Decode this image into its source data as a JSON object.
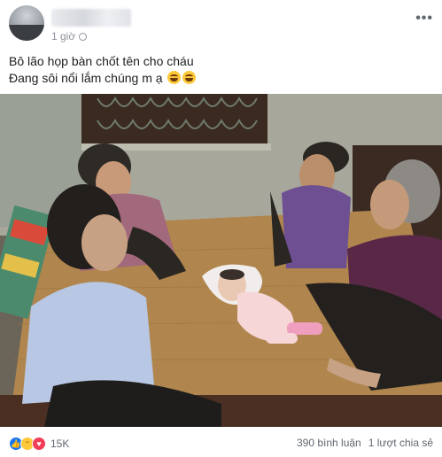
{
  "post": {
    "time": "1 giờ",
    "caption_line1": "Bô lão họp bàn chốt tên cho cháu",
    "caption_line2": "Đang sôi nổi lắm chúng m ạ"
  },
  "reactions": {
    "icons": [
      "like-icon",
      "haha-icon",
      "love-icon"
    ],
    "count": "15K"
  },
  "stats": {
    "comments": "390 bình luận",
    "shares": "1 lượt chia sẻ"
  },
  "colors": {
    "like": "#1877f2",
    "love": "#f33e58",
    "haha": "#fdc83a",
    "meta_text": "#90949c"
  }
}
